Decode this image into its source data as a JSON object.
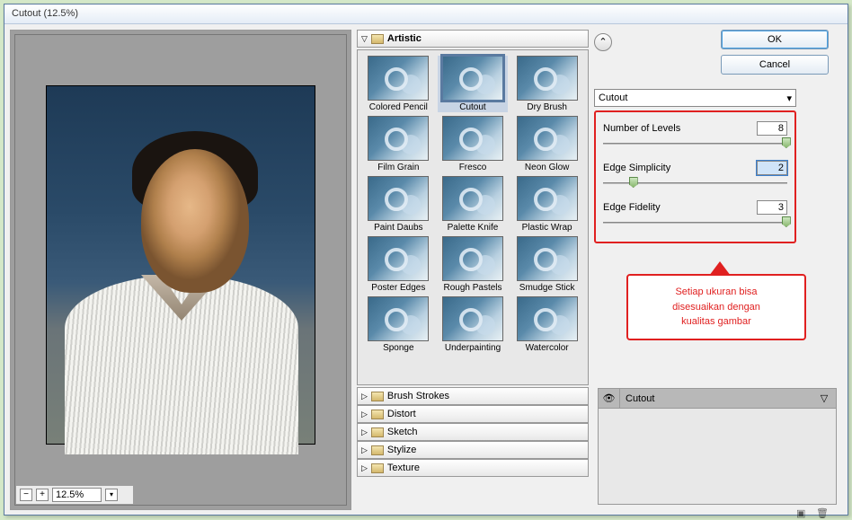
{
  "window": {
    "title": "Cutout (12.5%)"
  },
  "zoom": {
    "minus": "−",
    "plus": "+",
    "value": "12.5%",
    "drop": "▾"
  },
  "gallery": {
    "category": "Artistic",
    "items": [
      {
        "label": "Colored Pencil"
      },
      {
        "label": "Cutout"
      },
      {
        "label": "Dry Brush"
      },
      {
        "label": "Film Grain"
      },
      {
        "label": "Fresco"
      },
      {
        "label": "Neon Glow"
      },
      {
        "label": "Paint Daubs"
      },
      {
        "label": "Palette Knife"
      },
      {
        "label": "Plastic Wrap"
      },
      {
        "label": "Poster Edges"
      },
      {
        "label": "Rough Pastels"
      },
      {
        "label": "Smudge Stick"
      },
      {
        "label": "Sponge"
      },
      {
        "label": "Underpainting"
      },
      {
        "label": "Watercolor"
      }
    ],
    "collapsed": [
      "Brush Strokes",
      "Distort",
      "Sketch",
      "Stylize",
      "Texture"
    ]
  },
  "buttons": {
    "ok": "OK",
    "cancel": "Cancel",
    "collapse": "☆"
  },
  "dropdown": {
    "value": "Cutout",
    "arrow": "▾"
  },
  "settings": {
    "levels": {
      "label": "Number of Levels",
      "value": "8",
      "pos": "97%"
    },
    "simp": {
      "label": "Edge Simplicity",
      "value": "2",
      "pos": "14%"
    },
    "fidelity": {
      "label": "Edge Fidelity",
      "value": "3",
      "pos": "97%"
    }
  },
  "callout": {
    "l1": "Setiap ukuran bisa",
    "l2": "disesuaikan dengan",
    "l3": "kualitas gambar"
  },
  "layers": {
    "name": "Cutout",
    "eye": "👁"
  },
  "tri": {
    "down": "▽",
    "right": "▷"
  }
}
